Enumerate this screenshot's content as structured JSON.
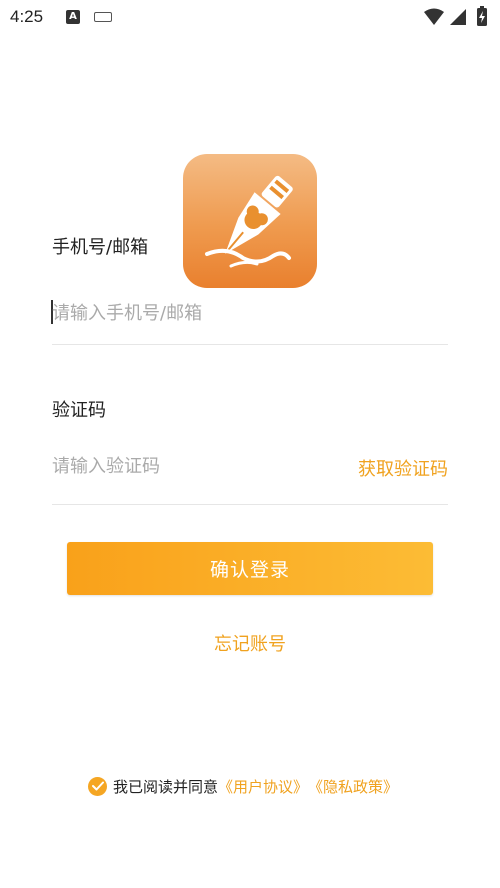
{
  "status_bar": {
    "time": "4:25",
    "a_glyph": "A"
  },
  "icons": {
    "notification": "a-icon",
    "keyboard": "keyboard-icon",
    "wifi": "wifi-icon",
    "signal": "signal-icon",
    "battery": "battery-charging-icon",
    "logo": "fountain-pen-logo-icon",
    "check": "check-circle-icon"
  },
  "colors": {
    "accent": "#f0a21f",
    "button_start": "#f9a11a",
    "button_end": "#fcbc35",
    "logo_top": "#f4bb84",
    "logo_bottom": "#e9802e"
  },
  "form": {
    "phone_label": "手机号/邮箱",
    "phone_placeholder": "请输入手机号/邮箱",
    "code_label": "验证码",
    "code_placeholder": "请输入验证码",
    "get_code": "获取验证码",
    "login": "确认登录",
    "forgot": "忘记账号"
  },
  "agreement": {
    "text": "我已阅读并同意",
    "user_agreement": "《用户协议》",
    "privacy_policy": "《隐私政策》",
    "checked": true
  }
}
